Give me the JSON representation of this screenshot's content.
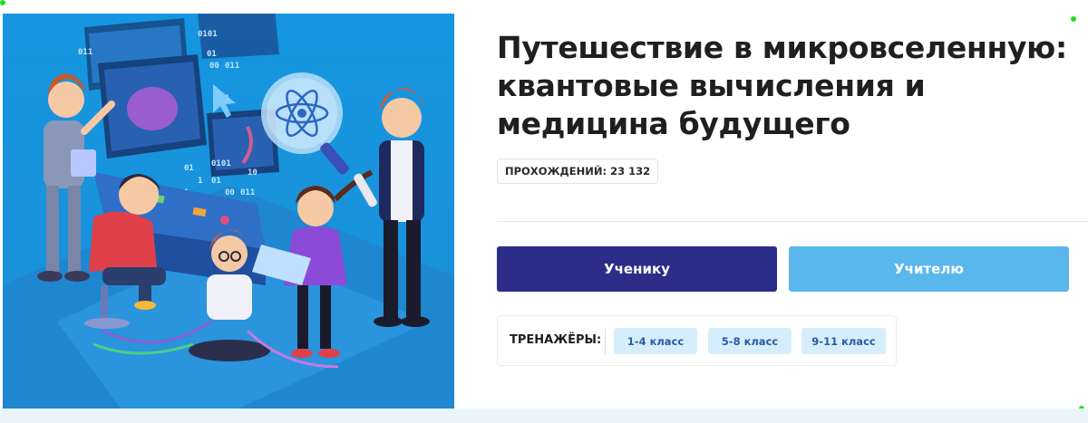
{
  "course": {
    "title": "Путешествие в микровселенную: квантовые вычисления и медицина будущего",
    "passes_label": "ПРОХОЖДЕНИЙ:",
    "passes_count": "23 132"
  },
  "roles": {
    "student_label": "Ученику",
    "teacher_label": "Учителю"
  },
  "trainers": {
    "label": "ТРЕНАЖЁРЫ:",
    "grades": [
      "1-4 класс",
      "5-8 класс",
      "9-11 класс"
    ]
  },
  "illustration": {
    "binary_texts": [
      "0101",
      "011",
      "01",
      "00",
      "011",
      "1",
      "0101",
      "10",
      "01",
      "1",
      "01",
      "1",
      "00",
      "011"
    ]
  },
  "colors": {
    "illustration_bg": "#1e9be2",
    "student_button": "#2b2d89",
    "teacher_button": "#5ab7ec",
    "grade_chip_bg": "#d6eefb",
    "grade_chip_text": "#2a5aa5"
  }
}
